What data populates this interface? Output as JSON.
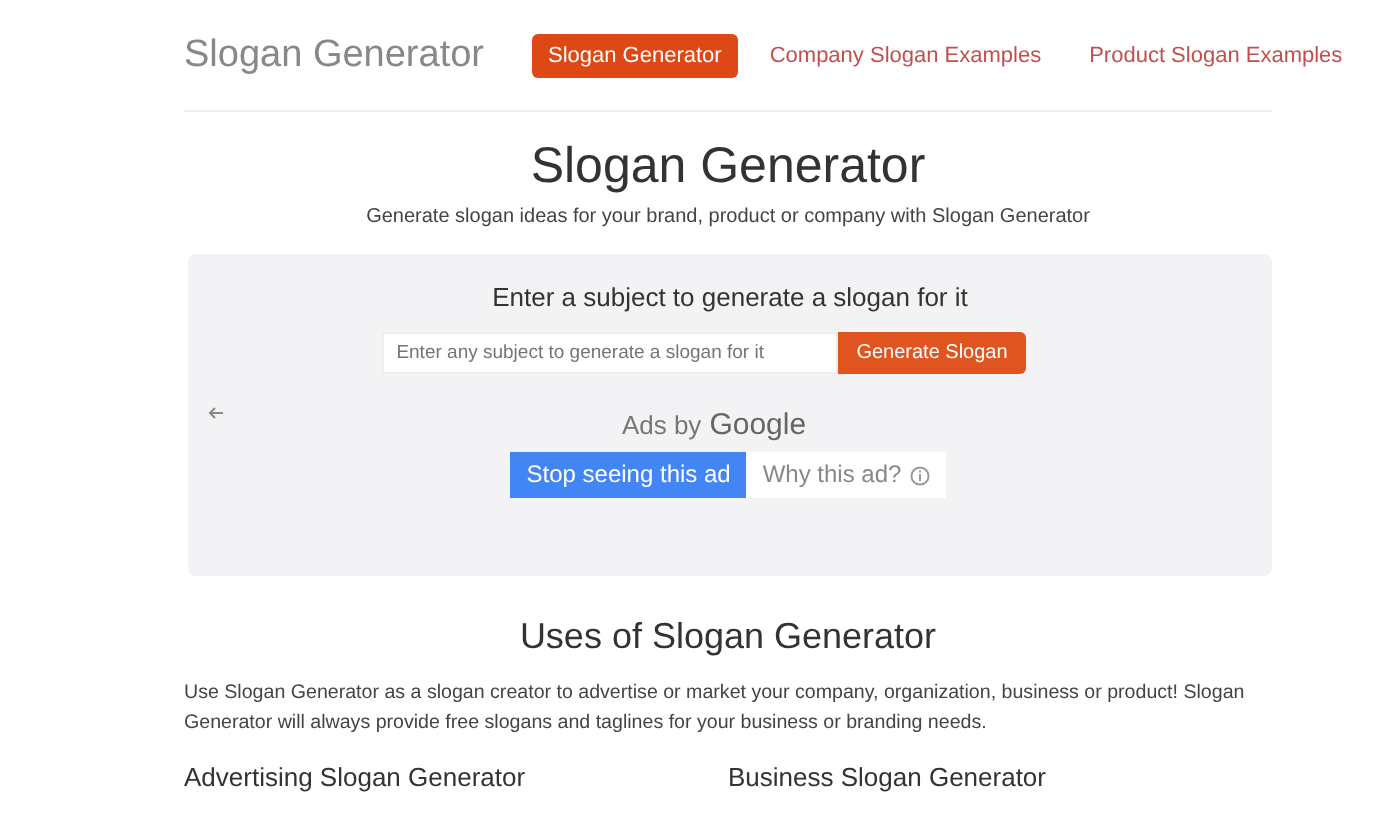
{
  "brand": "Slogan Generator",
  "nav": [
    {
      "label": "Slogan Generator",
      "selected": true
    },
    {
      "label": "Company Slogan Examples",
      "selected": false
    },
    {
      "label": "Product Slogan Examples",
      "selected": false
    }
  ],
  "title": "Slogan Generator",
  "subtitle": "Generate slogan ideas for your brand, product or company with Slogan Generator",
  "generator": {
    "heading": "Enter a subject to generate a slogan for it",
    "placeholder": "Enter any subject to generate a slogan for it",
    "button": "Generate Slogan"
  },
  "ad": {
    "label": "Ads by",
    "brand": "Google",
    "buttons": [
      {
        "label": "Stop seeing this ad",
        "kind": "primary"
      },
      {
        "label": "Why this ad?",
        "kind": "info"
      }
    ]
  },
  "uses": {
    "heading": "Uses of Slogan Generator",
    "text": "Use Slogan Generator as a slogan creator to advertise or market your company, organization, business or product! Slogan Generator will always provide free slogans and taglines for your business or branding needs.",
    "subheadings": [
      "Advertising Slogan Generator",
      "Business Slogan Generator"
    ]
  }
}
